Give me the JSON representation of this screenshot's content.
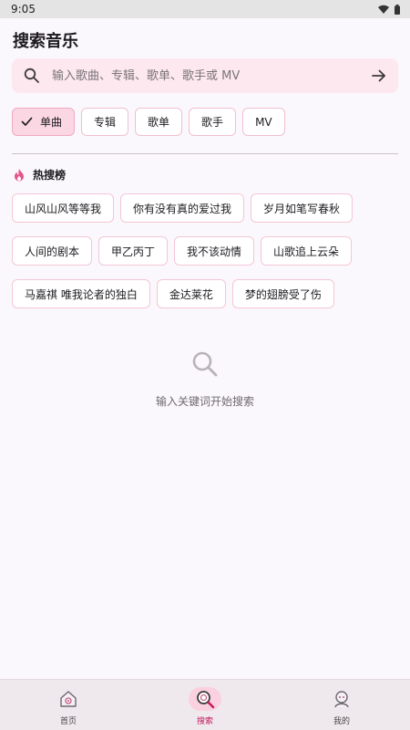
{
  "status_bar": {
    "time": "9:05"
  },
  "page": {
    "title": "搜索音乐"
  },
  "search": {
    "placeholder": "输入歌曲、专辑、歌单、歌手或 MV",
    "value": ""
  },
  "filters": [
    {
      "label": "单曲",
      "selected": true
    },
    {
      "label": "专辑",
      "selected": false
    },
    {
      "label": "歌单",
      "selected": false
    },
    {
      "label": "歌手",
      "selected": false
    },
    {
      "label": "MV",
      "selected": false
    }
  ],
  "hot": {
    "title": "热搜榜",
    "rows": [
      [
        "山风山风等等我",
        "你有没有真的爱过我",
        "岁月如笔写春秋"
      ],
      [
        "人间的剧本",
        "甲乙丙丁",
        "我不该动情",
        "山歌追上云朵"
      ],
      [
        "马嘉祺 唯我论者的独白",
        "金达莱花",
        "梦的翅膀受了伤"
      ]
    ]
  },
  "empty_state": {
    "hint": "输入关键词开始搜索",
    "icon": "search-icon"
  },
  "nav": [
    {
      "label": "首页",
      "icon": "home-icon",
      "active": false
    },
    {
      "label": "搜索",
      "icon": "search-icon",
      "active": true
    },
    {
      "label": "我的",
      "icon": "profile-icon",
      "active": false
    }
  ],
  "colors": {
    "accent": "#c2185b",
    "chip_selected": "#fbd7e3",
    "search_bg": "#fde8ef"
  }
}
